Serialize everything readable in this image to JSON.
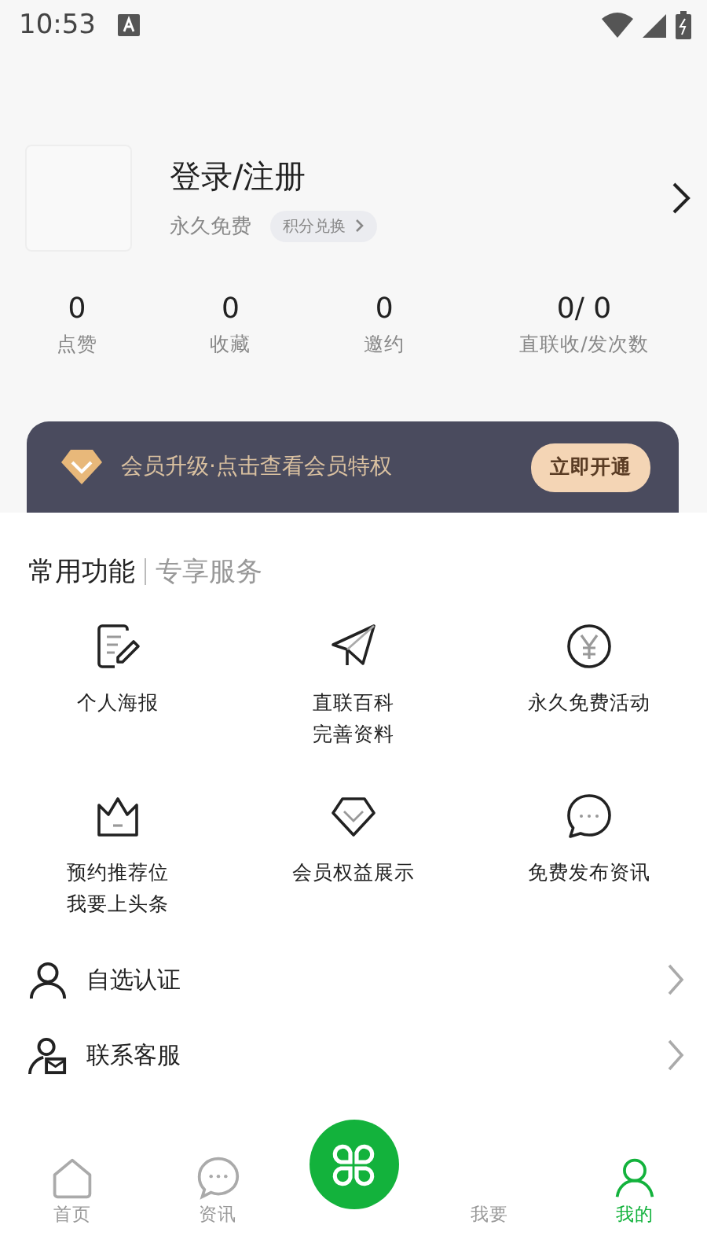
{
  "status_bar": {
    "time": "10:53"
  },
  "profile": {
    "title": "登录/注册",
    "subtitle": "永久免费",
    "points_button": "积分兑换"
  },
  "stats": [
    {
      "value": "0",
      "label": "点赞"
    },
    {
      "value": "0",
      "label": "收藏"
    },
    {
      "value": "0",
      "label": "邀约"
    },
    {
      "value": "0/ 0",
      "label": "直联收/发次数"
    }
  ],
  "banner": {
    "text": "会员升级·点击查看会员特权",
    "button": "立即开通"
  },
  "section_tabs": [
    {
      "label": "常用功能",
      "selected": true
    },
    {
      "label": "专享服务",
      "selected": false
    }
  ],
  "features": [
    {
      "lines": [
        "个人海报"
      ]
    },
    {
      "lines": [
        "直联百科",
        "完善资料"
      ]
    },
    {
      "lines": [
        "永久免费活动"
      ]
    },
    {
      "lines": [
        "预约推荐位",
        "我要上头条"
      ]
    },
    {
      "lines": [
        "会员权益展示"
      ]
    },
    {
      "lines": [
        "免费发布资讯"
      ]
    }
  ],
  "menu": [
    {
      "label": "自选认证"
    },
    {
      "label": "联系客服"
    }
  ],
  "bottom_nav": [
    {
      "label": "首页",
      "selected": false
    },
    {
      "label": "资讯",
      "selected": false
    },
    {
      "label": "我要",
      "selected": false
    },
    {
      "label": "我的",
      "selected": true
    }
  ]
}
